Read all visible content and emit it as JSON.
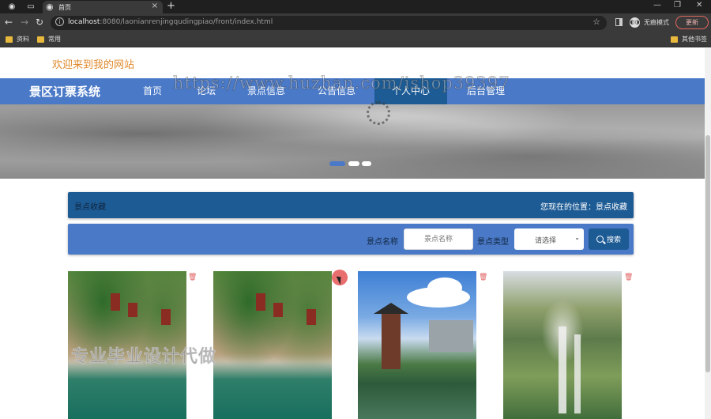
{
  "browser": {
    "tab_title": "首页",
    "url_host": "localhost",
    "url_rest": ":8080/laonianrenjingqudingpiao/front/index.html",
    "incognito_label": "无痕模式",
    "update_label": "更新",
    "bookmarks": [
      "资料",
      "常用"
    ],
    "other_bookmarks": "其他书签"
  },
  "header": {
    "welcome": "欢迎来到我的网站",
    "site_title": "景区订票系统"
  },
  "nav": {
    "items": [
      "首页",
      "论坛",
      "景点信息",
      "公告信息",
      "个人中心",
      "后台管理"
    ],
    "active_index": 4
  },
  "banner": {
    "slide_count": 3,
    "active_slide": 1
  },
  "section": {
    "title": "景点收藏",
    "location": "您现在的位置：景点收藏"
  },
  "search": {
    "name_label": "景点名称",
    "name_placeholder": "景点名称",
    "type_label": "景点类型",
    "type_selected": "请选择",
    "button_label": "搜索"
  },
  "cards": [
    {
      "image": "cliff-village-river"
    },
    {
      "image": "cliff-village-river"
    },
    {
      "image": "pagoda-lake"
    },
    {
      "image": "waterfall-cliff"
    }
  ],
  "watermarks": {
    "url": "https://www.huzhan.com/ishop39397",
    "text": "专业毕业设计代做"
  },
  "colors": {
    "nav_blue": "#4a79c7",
    "dark_blue": "#1d5b95",
    "welcome_orange": "#e08a2c"
  }
}
